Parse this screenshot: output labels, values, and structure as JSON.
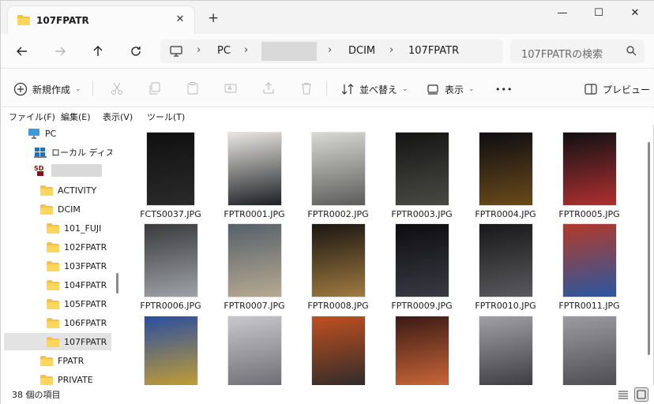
{
  "tab": {
    "title": "107FPATR",
    "close": "✕",
    "new_tab": "+"
  },
  "window_controls": {
    "minimize": "—",
    "maximize": "☐",
    "close": "✕"
  },
  "breadcrumb": {
    "pc": "PC",
    "dcim": "DCIM",
    "current": "107FPATR"
  },
  "search": {
    "placeholder": "107FPATRの検索"
  },
  "commands": {
    "new": "新規作成",
    "sort": "並べ替え",
    "view": "表示",
    "more": "•••",
    "preview": "プレビュー"
  },
  "menu": {
    "file": "ファイル(F)",
    "edit": "編集(E)",
    "view": "表示(V)",
    "tools": "ツール(T)"
  },
  "nav": [
    {
      "label": "PC",
      "icon": "monitor-icon"
    },
    {
      "label": "ローカル ディスク",
      "icon": "drive-icon"
    },
    {
      "label": "",
      "icon": "sd-card-icon"
    },
    {
      "label": "ACTIVITY",
      "icon": "folder-icon"
    },
    {
      "label": "DCIM",
      "icon": "folder-icon"
    },
    {
      "label": "101_FUJI",
      "icon": "folder-icon"
    },
    {
      "label": "102FPATR",
      "icon": "folder-icon"
    },
    {
      "label": "103FPATR",
      "icon": "folder-icon"
    },
    {
      "label": "104FPATR",
      "icon": "folder-icon"
    },
    {
      "label": "105FPATR",
      "icon": "folder-icon"
    },
    {
      "label": "106FPATR",
      "icon": "folder-icon"
    },
    {
      "label": "107FPATR",
      "icon": "folder-icon",
      "selected": true
    },
    {
      "label": "FPATR",
      "icon": "folder-icon"
    },
    {
      "label": "PRIVATE",
      "icon": "folder-icon"
    }
  ],
  "files": [
    {
      "name": "FCTS0037.JPG",
      "tone": [
        "#101010",
        "#2a2a2a"
      ]
    },
    {
      "name": "FPTR0001.JPG",
      "tone": [
        "#e9e7e2",
        "#1d1f24"
      ]
    },
    {
      "name": "FPTR0002.JPG",
      "tone": [
        "#d8d8d4",
        "#5c5c5a"
      ]
    },
    {
      "name": "FPTR0003.JPG",
      "tone": [
        "#141414",
        "#4a4a44"
      ]
    },
    {
      "name": "FPTR0004.JPG",
      "tone": [
        "#0d0d12",
        "#6b4a1a"
      ]
    },
    {
      "name": "FPTR0005.JPG",
      "tone": [
        "#101014",
        "#b03030"
      ]
    },
    {
      "name": "FPTR0006.JPG",
      "tone": [
        "#3a3a3c",
        "#9ea2a8"
      ]
    },
    {
      "name": "FPTR0007.JPG",
      "tone": [
        "#55606a",
        "#b8aa92"
      ]
    },
    {
      "name": "FPTR0008.JPG",
      "tone": [
        "#1a1612",
        "#a07a40"
      ]
    },
    {
      "name": "FPTR0009.JPG",
      "tone": [
        "#0c0c10",
        "#3a3a44"
      ]
    },
    {
      "name": "FPTR0010.JPG",
      "tone": [
        "#18181a",
        "#5a5a5e"
      ]
    },
    {
      "name": "FPTR0011.JPG",
      "tone": [
        "#b23a2a",
        "#2a58a0"
      ]
    },
    {
      "name": "",
      "tone": [
        "#2a4ea0",
        "#c8a030"
      ]
    },
    {
      "name": "",
      "tone": [
        "#c8c8cc",
        "#6a6a70"
      ]
    },
    {
      "name": "",
      "tone": [
        "#c05020",
        "#2a2a2a"
      ]
    },
    {
      "name": "",
      "tone": [
        "#3a1a14",
        "#d06a3a"
      ]
    },
    {
      "name": "",
      "tone": [
        "#a0a0a4",
        "#3a3a3e"
      ]
    },
    {
      "name": "",
      "tone": [
        "#9c9ca0",
        "#4a4a4e"
      ]
    }
  ],
  "status": {
    "count": "38 個の項目"
  }
}
